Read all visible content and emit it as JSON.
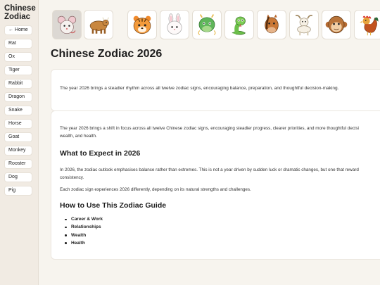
{
  "sidebar": {
    "brand_line1": "Chinese",
    "brand_line2": "Zodiac",
    "items": [
      {
        "label": "← Home"
      },
      {
        "label": "Rat"
      },
      {
        "label": "Ox"
      },
      {
        "label": "Tiger"
      },
      {
        "label": "Rabbit"
      },
      {
        "label": "Dragon"
      },
      {
        "label": "Snake"
      },
      {
        "label": "Horse"
      },
      {
        "label": "Goat"
      },
      {
        "label": "Monkey"
      },
      {
        "label": "Rooster"
      },
      {
        "label": "Dog"
      },
      {
        "label": "Pig"
      }
    ]
  },
  "icon_strip": [
    {
      "icon": "rat-icon",
      "selected": true
    },
    {
      "icon": "ox-icon"
    },
    {
      "icon": "tiger-icon"
    },
    {
      "icon": "rabbit-icon"
    },
    {
      "icon": "dragon-icon"
    },
    {
      "icon": "snake-icon"
    },
    {
      "icon": "horse-icon"
    },
    {
      "icon": "goat-icon"
    },
    {
      "icon": "monkey-icon"
    },
    {
      "icon": "rooster-icon"
    }
  ],
  "page": {
    "title": "Chinese Zodiac 2026",
    "intro": "The year 2026 brings a steadier rhythm across all twelve zodiac signs, encouraging balance, preparation, and thoughtful decision-making.",
    "lead_line1": "The year 2026 brings a shift in focus across all twelve Chinese zodiac signs, encouraging steadier progress, clearer priorities, and more thoughtful decisi",
    "lead_line2": "wealth, and health.",
    "section1_heading": "What to Expect in 2026",
    "section1_p1_line1": "In 2026, the zodiac outlook emphasises balance rather than extremes. This is not a year driven by sudden luck or dramatic changes, but one that reward",
    "section1_p1_line2": "consistency.",
    "section1_p2": "Each zodiac sign experiences 2026 differently, depending on its natural strengths and challenges.",
    "section2_heading": "How to Use This Zodiac Guide",
    "guide_items": [
      "Career & Work",
      "Relationships",
      "Wealth",
      "Health"
    ]
  },
  "colors": {
    "background": "#f7f4ee",
    "sidebar_bg": "#f1ebe3",
    "card_bg": "#ffffff",
    "selected_card": "#dcd8d3"
  }
}
